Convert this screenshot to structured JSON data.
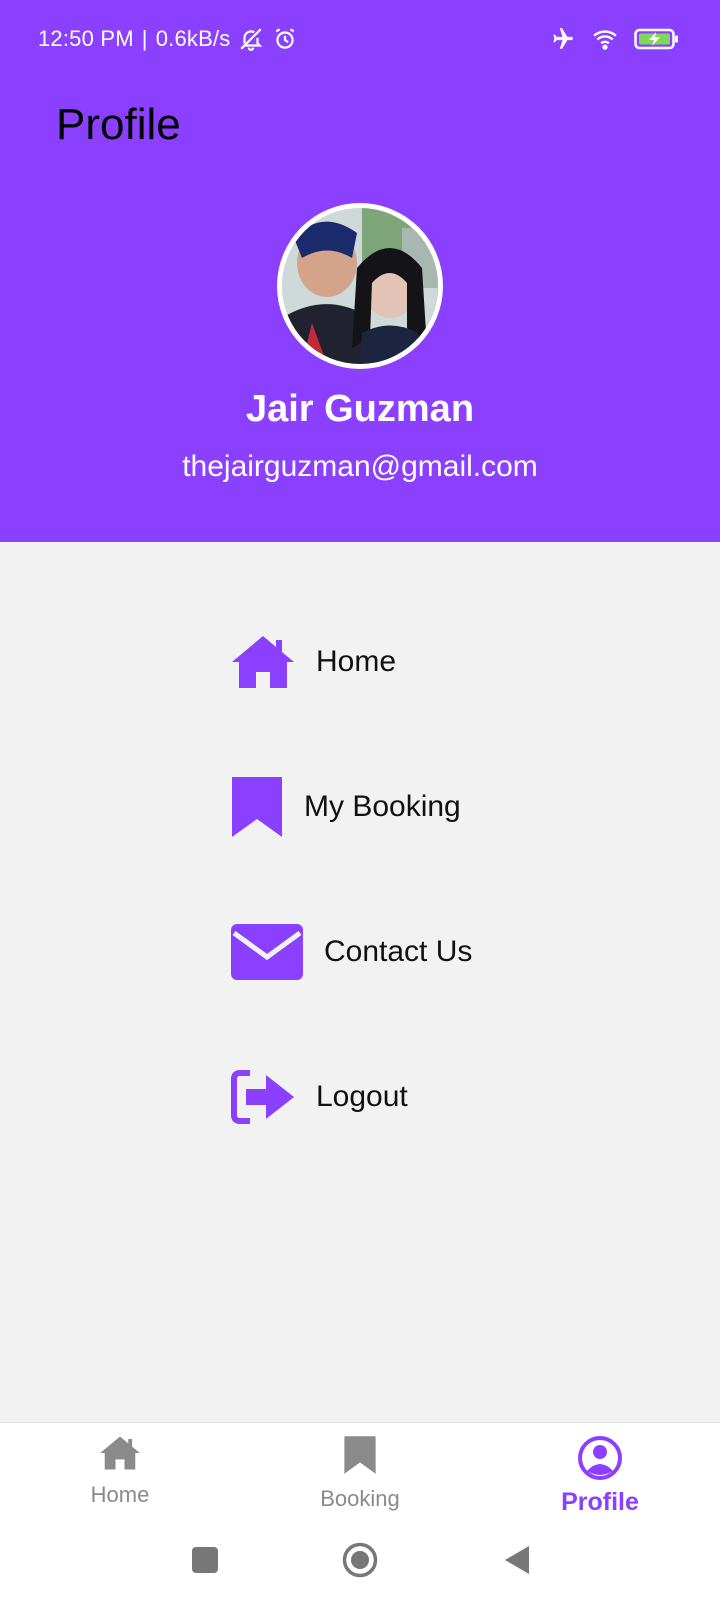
{
  "status_bar": {
    "time": "12:50 PM",
    "network_speed": "0.6kB/s",
    "icons": [
      "mute-notifications-icon",
      "alarm-icon",
      "airplane-icon",
      "wifi-icon",
      "battery-charging-icon"
    ]
  },
  "header": {
    "title": "Profile",
    "background_color": "#8c40ff"
  },
  "profile": {
    "name": "Jair Guzman",
    "email": "thejairguzman@gmail.com"
  },
  "menu": {
    "items": [
      {
        "label": "Home",
        "icon": "home-icon"
      },
      {
        "label": "My Booking",
        "icon": "bookmark-icon"
      },
      {
        "label": "Contact Us",
        "icon": "envelope-icon"
      },
      {
        "label": "Logout",
        "icon": "logout-icon"
      }
    ],
    "icon_color": "#8c40ff"
  },
  "bottom_nav": {
    "items": [
      {
        "label": "Home",
        "icon": "home-icon",
        "active": false
      },
      {
        "label": "Booking",
        "icon": "bookmark-icon",
        "active": false
      },
      {
        "label": "Profile",
        "icon": "user-circle-icon",
        "active": true
      }
    ],
    "active_color": "#8c40ff",
    "inactive_color": "#8a8a8a"
  },
  "system_nav": {
    "buttons": [
      "recents-button",
      "home-button",
      "back-button"
    ]
  }
}
